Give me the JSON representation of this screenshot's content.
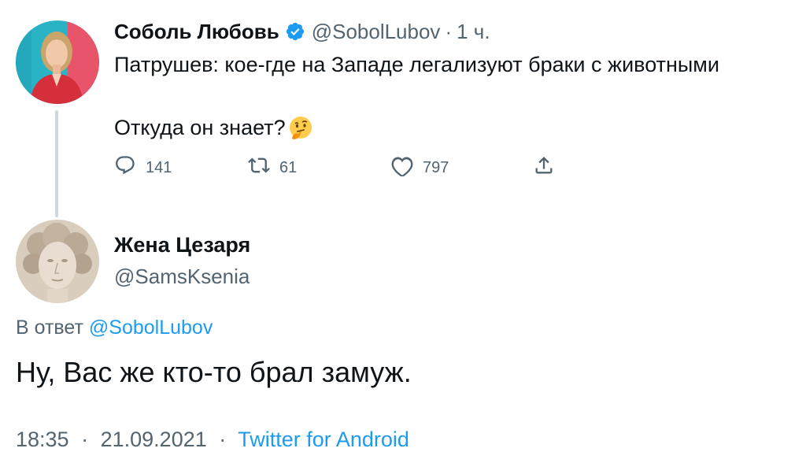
{
  "tweet": {
    "author_name": "Соболь Любовь",
    "author_handle": "@SobolLubov",
    "separator": "·",
    "time_ago": "1 ч.",
    "line1": "Патрушев: кое-где на Западе легализуют браки с животными",
    "line2": "Откуда он знает?",
    "emoji": "thinking-face",
    "actions": {
      "reply_count": "141",
      "retweet_count": "61",
      "like_count": "797"
    }
  },
  "reply": {
    "author_name": "Жена Цезаря",
    "author_handle": "@SamsKsenia",
    "reply_prefix": "В ответ",
    "reply_mention": "@SobolLubov",
    "body": "Ну, Вас же кто-то брал замуж.",
    "time": "18:35",
    "date": "21.09.2021",
    "separator": "·",
    "source": "Twitter for Android"
  },
  "colors": {
    "text": "#0f1419",
    "secondary": "#536471",
    "accent": "#1d9bf0",
    "thread_line": "#cfd9de"
  },
  "icons": {
    "verified": "verified-badge-icon",
    "reply": "reply-icon",
    "retweet": "retweet-icon",
    "like": "heart-icon",
    "share": "share-icon"
  }
}
